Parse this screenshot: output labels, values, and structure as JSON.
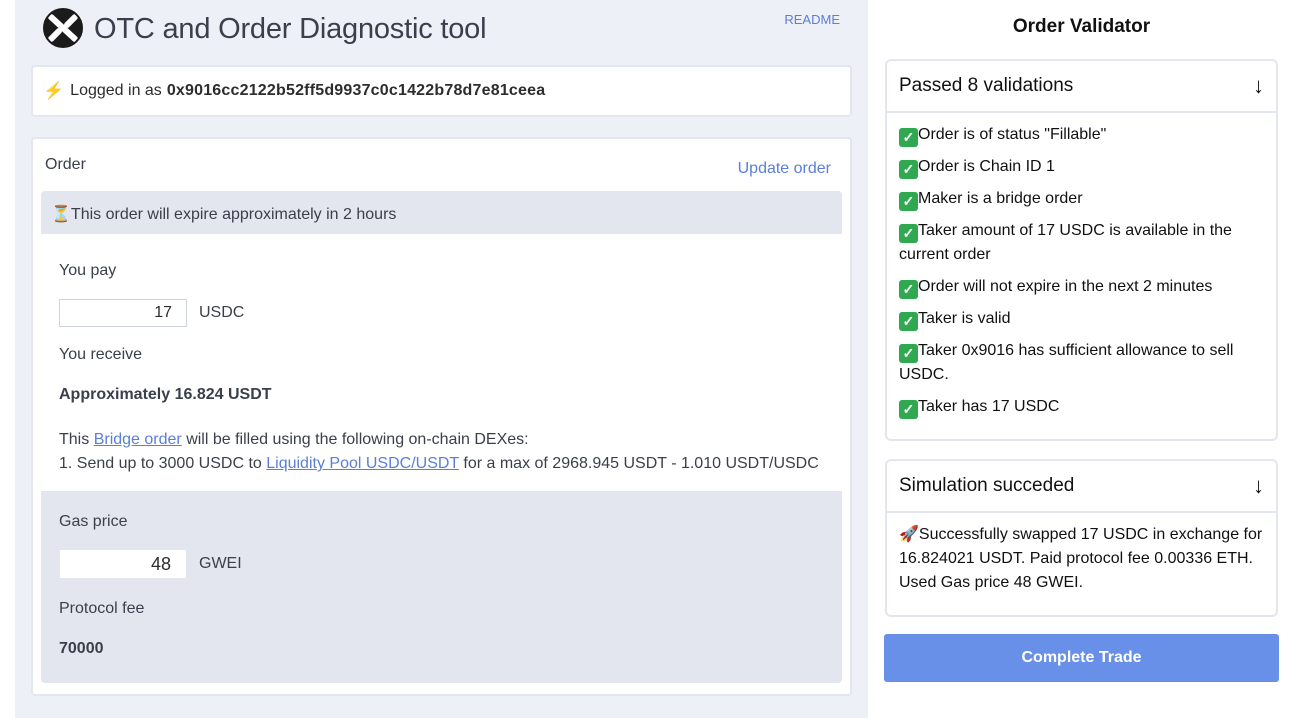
{
  "header": {
    "title": "OTC and Order Diagnostic tool",
    "readme": "README",
    "logo_icon": "0x-logo-icon"
  },
  "login": {
    "icon": "⚡",
    "prefix": "Logged in as",
    "address": "0x9016cc2122b52ff5d9937c0c1422b78d7e81ceea"
  },
  "order": {
    "label": "Order",
    "update_link": "Update order",
    "expire_icon": "⏳",
    "expire_text": "This order will expire approximately in 2 hours",
    "you_pay_label": "You pay",
    "pay_amount": "17",
    "pay_token": "USDC",
    "you_receive_label": "You receive",
    "receive_text": "Approximately 16.824 USDT",
    "bridge_prefix": "This",
    "bridge_link": "Bridge order",
    "bridge_suffix": "will be filled using the following on-chain DEXes:",
    "route_prefix": "1. Send up to 3000 USDC to",
    "route_link": "Liquidity Pool USDC/USDT",
    "route_suffix": "for a max of 2968.945 USDT - 1.010 USDT/USDC",
    "gas_label": "Gas price",
    "gas_value": "48",
    "gas_unit": "GWEI",
    "fee_label": "Protocol fee",
    "fee_value": "70000"
  },
  "validator": {
    "title": "Order Validator",
    "validations_header": "Passed 8 validations",
    "validations": [
      "Order is of status \"Fillable\"",
      "Order is Chain ID 1",
      "Maker is a bridge order",
      "Taker amount of 17 USDC is available in the current order",
      "Order will not expire in the next 2 minutes",
      "Taker is valid",
      "Taker 0x9016 has sufficient allowance to sell USDC.",
      "Taker has 17 USDC"
    ],
    "simulation_header": "Simulation succeded",
    "simulation_text": "Successfully swapped 17 USDC in exchange for 16.824021 USDT. Paid protocol fee 0.00336 ETH. Used Gas price 48 GWEI.",
    "arrow": "↓"
  },
  "actions": {
    "complete_trade": "Complete Trade"
  },
  "colors": {
    "accent": "#5b7fd6",
    "button": "#6890e8",
    "panel_bg": "#eef0f7",
    "check": "#2fa84f"
  }
}
